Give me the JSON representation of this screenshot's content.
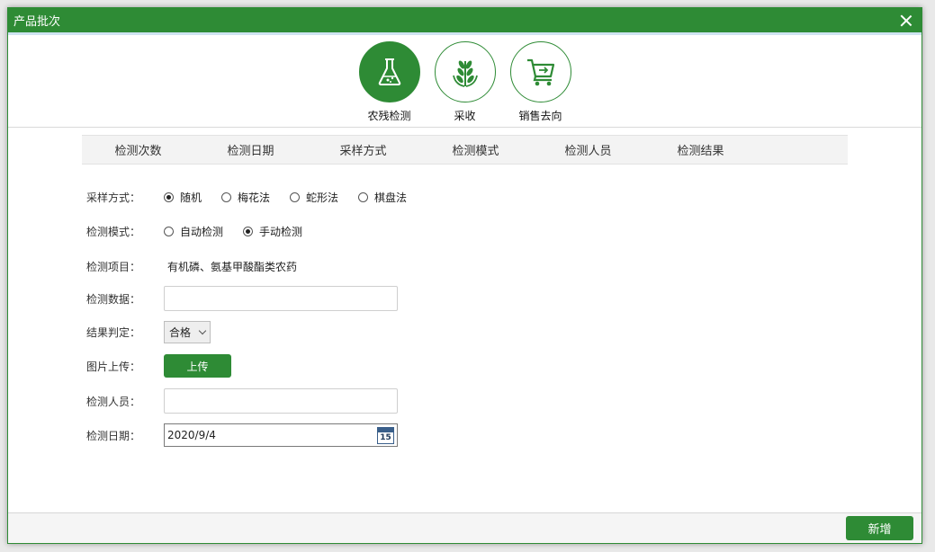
{
  "dialog": {
    "title": "产品批次"
  },
  "steps": [
    {
      "label": "农残检测",
      "icon": "flask-icon",
      "active": true
    },
    {
      "label": "采收",
      "icon": "wheat-icon",
      "active": false
    },
    {
      "label": "销售去向",
      "icon": "shopping-cart-icon",
      "active": false
    }
  ],
  "tabs": [
    "检测次数",
    "检测日期",
    "采样方式",
    "检测模式",
    "检测人员",
    "检测结果"
  ],
  "form": {
    "sampling": {
      "label": "采样方式：",
      "options": [
        "随机",
        "梅花法",
        "蛇形法",
        "棋盘法"
      ],
      "selected": "随机"
    },
    "mode": {
      "label": "检测模式：",
      "options": [
        "自动检测",
        "手动检测"
      ],
      "selected": "手动检测"
    },
    "item": {
      "label": "检测项目：",
      "value": "有机磷、氨基甲酸酯类农药"
    },
    "data": {
      "label": "检测数据：",
      "value": ""
    },
    "result": {
      "label": "结果判定：",
      "value": "合格"
    },
    "image": {
      "label": "图片上传：",
      "button": "上传"
    },
    "person": {
      "label": "检测人员：",
      "value": ""
    },
    "date": {
      "label": "检测日期：",
      "value": "2020/9/4",
      "calendar_day": "15"
    }
  },
  "footer": {
    "add_button": "新增"
  },
  "colors": {
    "brand": "#2e8b35"
  }
}
